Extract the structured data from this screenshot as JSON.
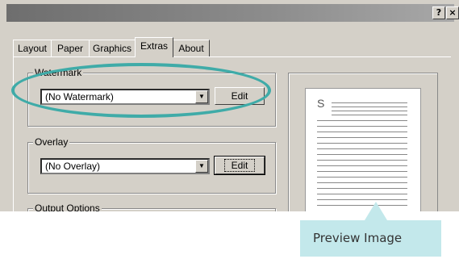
{
  "window": {
    "title": "",
    "help_button": "?",
    "close_button": "×"
  },
  "tabs": [
    {
      "label": "Layout"
    },
    {
      "label": "Paper"
    },
    {
      "label": "Graphics"
    },
    {
      "label": "Extras",
      "active": true
    },
    {
      "label": "About"
    }
  ],
  "watermark": {
    "group_label": "Watermark",
    "selected": "(No Watermark)",
    "edit_button": "Edit"
  },
  "overlay": {
    "group_label": "Overlay",
    "selected": "(No Overlay)",
    "edit_button": "Edit"
  },
  "output_options": {
    "group_label": "Output Options"
  },
  "preview": {
    "page_letter": "S"
  },
  "callout": {
    "text": "Preview Image",
    "background": "#c3e8eb"
  },
  "highlight": {
    "color": "#3faba8"
  }
}
